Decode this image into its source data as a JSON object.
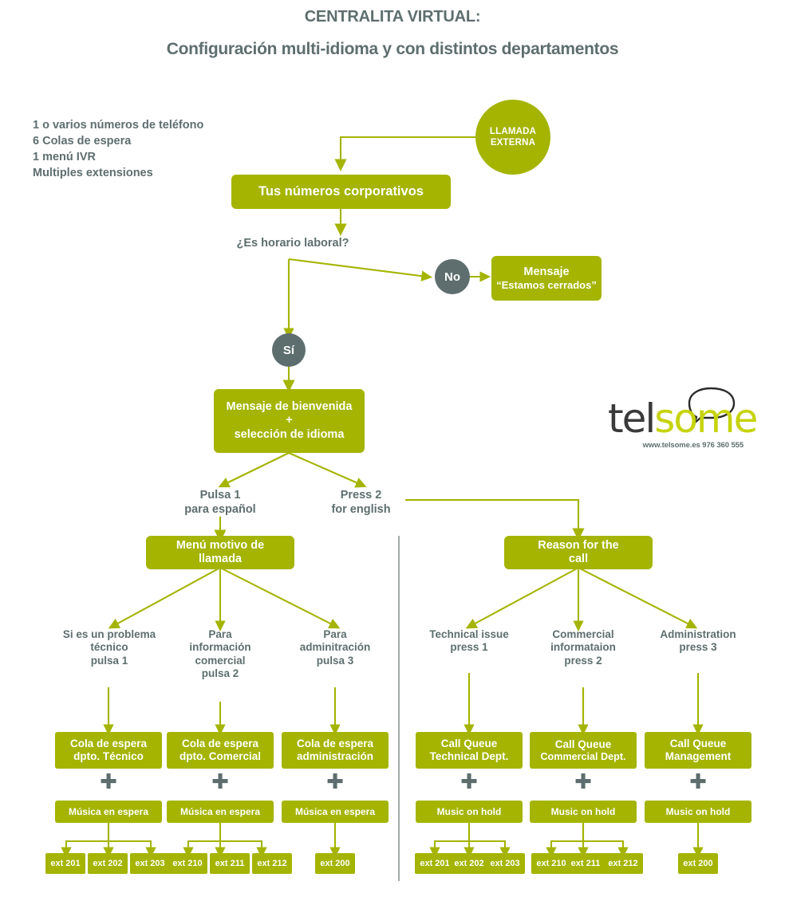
{
  "header": {
    "title": "CENTRALITA VIRTUAL:",
    "subtitle": "Configuración multi-idioma y con distintos departamentos"
  },
  "legend": {
    "lines": [
      "1 o varios números de teléfono",
      "6 Colas de espera",
      "1 menú IVR",
      "Multiples extensiones"
    ],
    "text": "1 o varios números de teléfono\n6 Colas de espera\n1 menú IVR\nMultiples extensiones"
  },
  "colors": {
    "green": "#a4b400",
    "gray": "#5e6e6e",
    "logo_green": "#c6d30a",
    "logo_dark": "#3a3a3a",
    "divider": "#8a9595",
    "background": "#ffffff"
  },
  "flow": {
    "entry_circle": {
      "line1": "LLAMADA",
      "line2": "EXTERNA"
    },
    "corporate_numbers": "Tus números corporativos",
    "decision_question": "¿Es horario laboral?",
    "decision_no": "No",
    "decision_yes": "Sí",
    "closed_message": {
      "line1": "Mensaje",
      "line2": "“Estamos cerrados”"
    },
    "welcome": {
      "line1": "Mensaje de bienvenida",
      "line2": "+",
      "line3": "selección de idioma"
    },
    "lang_es": {
      "line1": "Pulsa 1",
      "line2": "para español"
    },
    "lang_en": {
      "line1": "Press 2",
      "line2": "for english"
    }
  },
  "branch_es": {
    "menu_box": {
      "line1": "Menú motivo de",
      "line2": "llamada"
    },
    "options": [
      {
        "line1": "Si es un problema",
        "line2": "técnico",
        "line3": "pulsa 1"
      },
      {
        "line1": "Para",
        "line2": "información",
        "line3": "comercial",
        "line4": "pulsa 2"
      },
      {
        "line1": "Para",
        "line2": "adminitración",
        "line3": "pulsa 3"
      }
    ],
    "queues": [
      {
        "line1": "Cola de espera",
        "line2": "dpto. Técnico"
      },
      {
        "line1": "Cola de espera",
        "line2": "dpto. Comercial"
      },
      {
        "line1": "Cola de espera",
        "line2": "administración"
      }
    ],
    "plus": "✚",
    "music": [
      "Música en espera",
      "Música en espera",
      "Música en espera"
    ],
    "extensions": [
      [
        "ext 201",
        "ext 202",
        "ext 203"
      ],
      [
        "ext 210",
        "ext 211",
        "ext 212"
      ],
      [
        "ext 200"
      ]
    ]
  },
  "branch_en": {
    "menu_box": {
      "line1": "Reason for the",
      "line2": "call"
    },
    "options": [
      {
        "line1": "Technical issue",
        "line2": "press 1"
      },
      {
        "line1": "Commercial",
        "line2": "informataion",
        "line3": "press 2"
      },
      {
        "line1": "Administration",
        "line2": "press 3"
      }
    ],
    "queues": [
      {
        "line1": "Call Queue",
        "line2": "Technical Dept."
      },
      {
        "line1": "Call Queue",
        "line2": "Commercial Dept."
      },
      {
        "line1": "Call Queue",
        "line2": "Management"
      }
    ],
    "plus": "✚",
    "music": [
      "Music on hold",
      "Music on hold",
      "Music on hold"
    ],
    "extensions": [
      [
        "ext 201",
        "ext 202",
        "ext 203"
      ],
      [
        "ext 210",
        "ext 211",
        "ext 212"
      ],
      [
        "ext 200"
      ]
    ]
  },
  "logo": {
    "part1": "tel",
    "part2": "some",
    "tagline": "www.telsome.es 976 360 555"
  }
}
